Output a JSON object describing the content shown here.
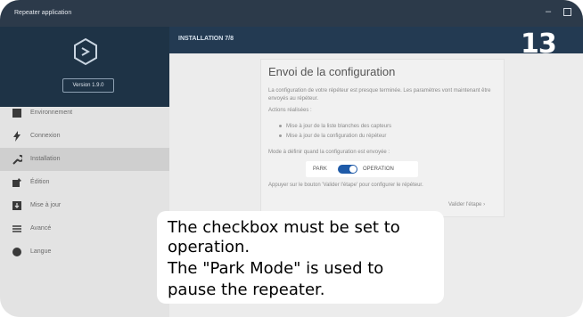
{
  "window": {
    "title": "Repeater application",
    "minimize_glyph": "–"
  },
  "sidebar": {
    "version": "Version 1.9.0",
    "items": [
      {
        "label": "Environnement",
        "icon": "grid-icon",
        "active": false
      },
      {
        "label": "Connexion",
        "icon": "bolt-icon",
        "active": false
      },
      {
        "label": "Installation",
        "icon": "wrench-icon",
        "active": true
      },
      {
        "label": "Édition",
        "icon": "edit-icon",
        "active": false
      },
      {
        "label": "Mise à jour",
        "icon": "download-icon",
        "active": false
      },
      {
        "label": "Avancé",
        "icon": "sliders-icon",
        "active": false
      },
      {
        "label": "Langue",
        "icon": "globe-icon",
        "active": false
      }
    ]
  },
  "main": {
    "step": "INSTALLATION 7/8",
    "card": {
      "title": "Envoi de la configuration",
      "description": "La configuration de votre répéteur est presque terminée. Les paramètres vont maintenant être envoyés au répéteur.",
      "actions_label": "Actions réalisées :",
      "bullets": [
        "Mise à jour de la liste blanches des capteurs",
        "Mise à jour de la configuration du répéteur"
      ],
      "mode_note": "Mode à définir quand la configuration est envoyée :",
      "toggle": {
        "off_label": "PARK",
        "on_label": "OPERATION",
        "value": "OPERATION"
      },
      "press_note": "Appuyer sur le bouton 'Valider l'étape' pour configurer le répéteur.",
      "validate_label": "Valider l'étape"
    }
  },
  "badge": "13",
  "callout": {
    "lines": [
      "The checkbox must be set to",
      "operation.",
      "The \"Park Mode\" is used to",
      "pause the repeater."
    ]
  },
  "colors": {
    "sidebar_brand": "#1e3346",
    "header": "#233a52",
    "toggle_on": "#1e5aa8"
  }
}
